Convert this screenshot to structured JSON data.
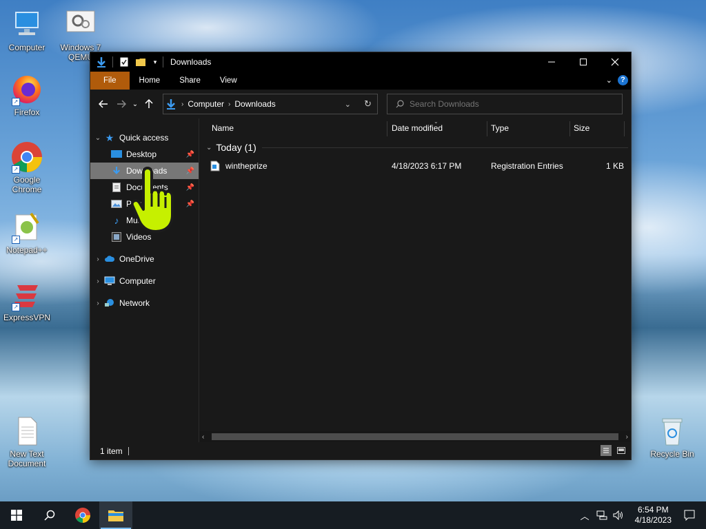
{
  "desktop": {
    "icons": [
      {
        "label": "Computer",
        "icon": "computer-icon"
      },
      {
        "label": "Windows 7 QEMU",
        "icon": "settings-gear-icon"
      },
      {
        "label": "Firefox",
        "icon": "firefox-icon"
      },
      {
        "label": "Google Chrome",
        "icon": "chrome-icon"
      },
      {
        "label": "Notepad++",
        "icon": "notepadpp-icon"
      },
      {
        "label": "ExpressVPN",
        "icon": "expressvpn-icon"
      },
      {
        "label": "New Text Document",
        "icon": "text-document-icon"
      },
      {
        "label": "Recycle Bin",
        "icon": "recycle-bin-icon"
      }
    ]
  },
  "window": {
    "title": "Downloads",
    "ribbon_tabs": [
      "File",
      "Home",
      "Share",
      "View"
    ],
    "help_label": "?",
    "address": {
      "crumbs": [
        "Computer",
        "Downloads"
      ]
    },
    "search": {
      "placeholder": "Search Downloads"
    },
    "nav": {
      "quick_access": "Quick access",
      "items": [
        {
          "label": "Desktop",
          "pinned": true
        },
        {
          "label": "Downloads",
          "pinned": true,
          "selected": true
        },
        {
          "label": "Documents",
          "pinned": true
        },
        {
          "label": "Pictures",
          "pinned": true
        },
        {
          "label": "Music",
          "pinned": false
        },
        {
          "label": "Videos",
          "pinned": false
        }
      ],
      "onedrive": "OneDrive",
      "computer": "Computer",
      "network": "Network"
    },
    "columns": {
      "name": "Name",
      "date": "Date modified",
      "type": "Type",
      "size": "Size"
    },
    "group": {
      "label": "Today (1)"
    },
    "files": [
      {
        "name": "wintheprize",
        "date": "4/18/2023 6:17 PM",
        "type": "Registration Entries",
        "size": "1 KB"
      }
    ],
    "status": {
      "count": "1 item"
    }
  },
  "taskbar": {
    "time": "6:54 PM",
    "date": "4/18/2023"
  },
  "colors": {
    "file_tab": "#b05b0b",
    "accent": "#1b73d1",
    "selected_nav": "#777777"
  }
}
